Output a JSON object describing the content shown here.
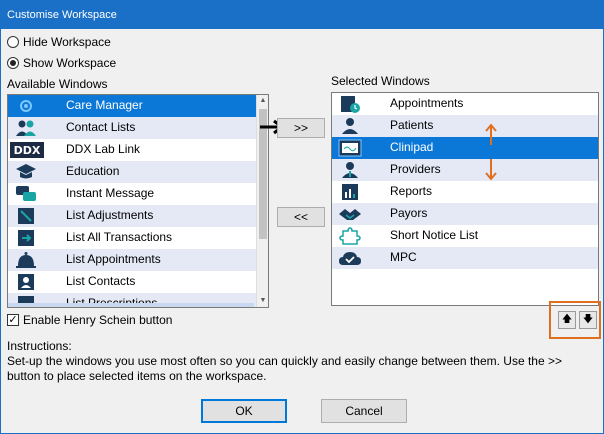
{
  "window": {
    "title": "Customise Workspace"
  },
  "workspace": {
    "hide_label": "Hide Workspace",
    "show_label": "Show Workspace",
    "selected": "show"
  },
  "available": {
    "header": "Available Windows",
    "items": [
      {
        "label": "Care Manager",
        "icon": "care-manager-icon",
        "selected": true
      },
      {
        "label": "Contact Lists",
        "icon": "contacts-icon"
      },
      {
        "label": "DDX Lab Link",
        "icon": "ddx-logo-icon"
      },
      {
        "label": "Education",
        "icon": "graduation-cap-icon"
      },
      {
        "label": "Instant Message",
        "icon": "chat-icon"
      },
      {
        "label": "List Adjustments",
        "icon": "list-adjust-icon"
      },
      {
        "label": "List All Transactions",
        "icon": "transactions-icon"
      },
      {
        "label": "List Appointments",
        "icon": "bell-icon"
      },
      {
        "label": "List Contacts",
        "icon": "contact-card-icon"
      },
      {
        "label": "List Prescriptions",
        "icon": "prescription-icon"
      }
    ]
  },
  "selected_windows": {
    "header": "Selected Windows",
    "items": [
      {
        "label": "Appointments",
        "icon": "calendar-icon"
      },
      {
        "label": "Patients",
        "icon": "person-icon"
      },
      {
        "label": "Clinipad",
        "icon": "clinipad-icon",
        "selected": true
      },
      {
        "label": "Providers",
        "icon": "providers-icon"
      },
      {
        "label": "Reports",
        "icon": "reports-icon"
      },
      {
        "label": "Payors",
        "icon": "handshake-icon"
      },
      {
        "label": "Short Notice List",
        "icon": "puzzle-icon"
      },
      {
        "label": "MPC",
        "icon": "cloud-check-icon"
      }
    ]
  },
  "buttons": {
    "add": ">>",
    "remove": "<<",
    "ok": "OK",
    "cancel": "Cancel",
    "move_up": "🡅",
    "move_down": "🡇"
  },
  "henry_schein": {
    "label": "Enable Henry Schein button",
    "checked": true
  },
  "instructions": {
    "heading": "Instructions:",
    "text": "Set-up the windows you use most often so you can quickly and easily change between them. Use the >> button to place selected items on the workspace."
  },
  "colors": {
    "accent": "#0b78d7",
    "alt_row": "#e5e9f6",
    "annotation": "#e07020"
  }
}
